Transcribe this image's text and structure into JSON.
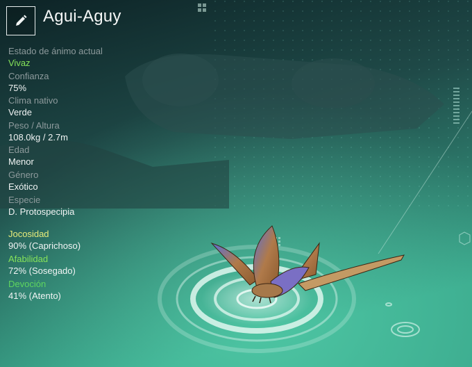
{
  "creature": {
    "name": "Agui-Aguy",
    "edit_icon": "pencil-icon"
  },
  "stats": [
    {
      "label": "Estado de ánimo actual",
      "value": "Vivaz",
      "value_color": "#86e35a"
    },
    {
      "label": "Confianza",
      "value": "75%"
    },
    {
      "label": "Clima nativo",
      "value": "Verde"
    },
    {
      "label": "Peso / Altura",
      "value": "108.0kg / 2.7m"
    },
    {
      "label": "Edad",
      "value": "Menor"
    },
    {
      "label": "Género",
      "value": "Exótico"
    },
    {
      "label": "Especie",
      "value": "D. Protospecipia"
    }
  ],
  "traits": [
    {
      "label": "Jocosidad",
      "value": "90% (Caprichoso)",
      "label_color": "#e8ec7a"
    },
    {
      "label": "Afabilidad",
      "value": "72% (Sosegado)",
      "label_color": "#86e35a"
    },
    {
      "label": "Devoción",
      "value": "41% (Atento)",
      "label_color": "#5fd65f"
    }
  ]
}
